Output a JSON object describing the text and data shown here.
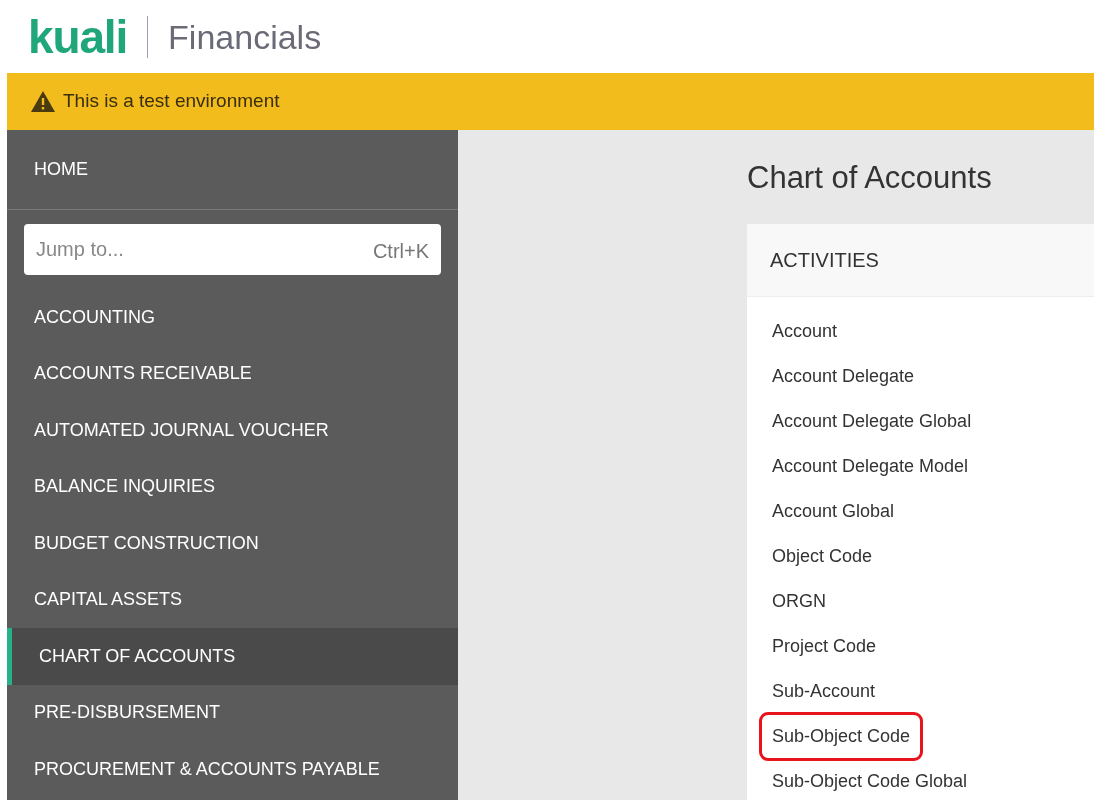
{
  "header": {
    "logo": "kuali",
    "product": "Financials"
  },
  "banner": {
    "message": "This is a test environment"
  },
  "sidebar": {
    "home": "HOME",
    "jump": {
      "placeholder": "Jump to...",
      "shortcut": "Ctrl+K"
    },
    "items": [
      {
        "label": "ACCOUNTING",
        "selected": false
      },
      {
        "label": "ACCOUNTS RECEIVABLE",
        "selected": false
      },
      {
        "label": "AUTOMATED JOURNAL VOUCHER",
        "selected": false
      },
      {
        "label": "BALANCE INQUIRIES",
        "selected": false
      },
      {
        "label": "BUDGET CONSTRUCTION",
        "selected": false
      },
      {
        "label": "CAPITAL ASSETS",
        "selected": false
      },
      {
        "label": "CHART OF ACCOUNTS",
        "selected": true
      },
      {
        "label": "PRE-DISBURSEMENT",
        "selected": false
      },
      {
        "label": "PROCUREMENT & ACCOUNTS PAYABLE",
        "selected": false
      }
    ]
  },
  "main": {
    "title": "Chart of Accounts",
    "card": {
      "heading": "ACTIVITIES",
      "items": [
        {
          "label": "Account",
          "highlighted": false
        },
        {
          "label": "Account Delegate",
          "highlighted": false
        },
        {
          "label": "Account Delegate Global",
          "highlighted": false
        },
        {
          "label": "Account Delegate Model",
          "highlighted": false
        },
        {
          "label": "Account Global",
          "highlighted": false
        },
        {
          "label": "Object Code",
          "highlighted": false
        },
        {
          "label": "ORGN",
          "highlighted": false
        },
        {
          "label": "Project Code",
          "highlighted": false
        },
        {
          "label": "Sub-Account",
          "highlighted": false
        },
        {
          "label": "Sub-Object Code",
          "highlighted": true
        },
        {
          "label": "Sub-Object Code Global",
          "highlighted": false
        }
      ]
    }
  }
}
